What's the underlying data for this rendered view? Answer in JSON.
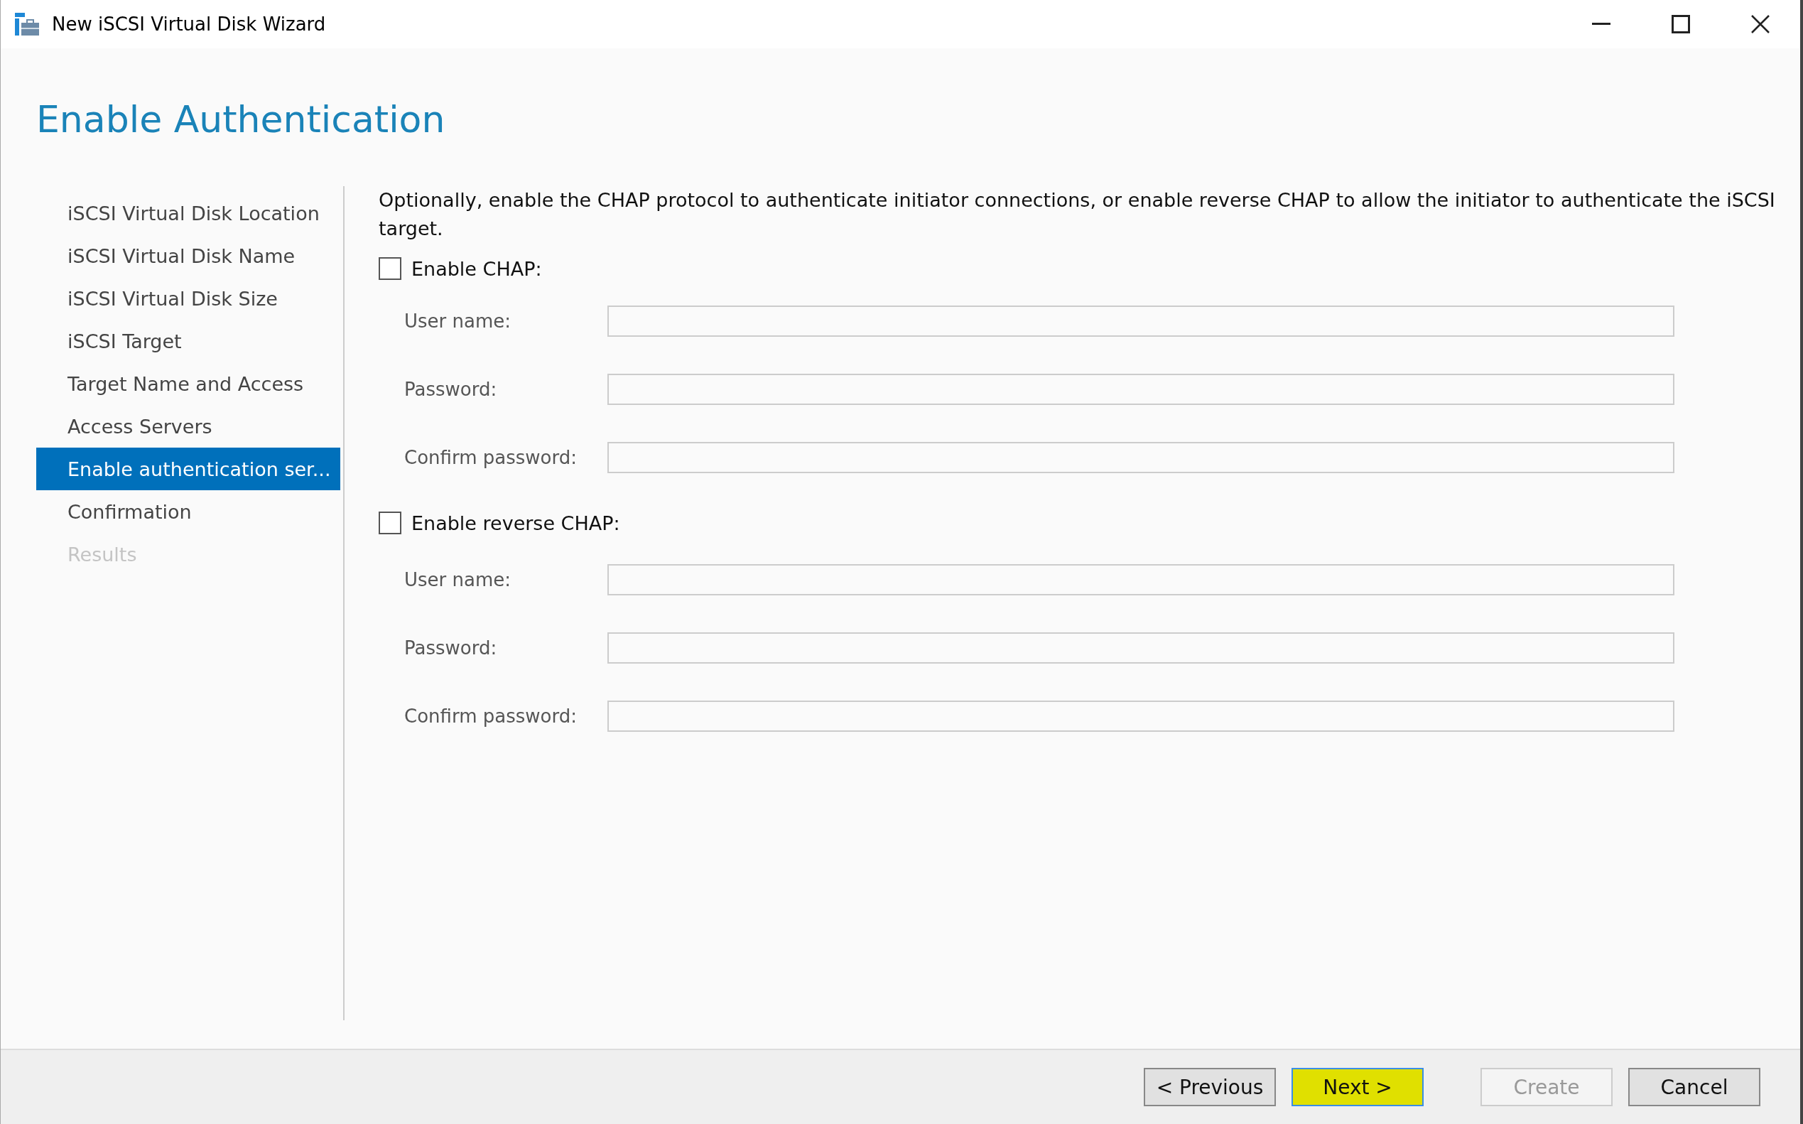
{
  "window": {
    "title": "New iSCSI Virtual Disk Wizard"
  },
  "heading": "Enable Authentication",
  "steps": [
    {
      "label": "iSCSI Virtual Disk Location",
      "selected": false,
      "disabled": false
    },
    {
      "label": "iSCSI Virtual Disk Name",
      "selected": false,
      "disabled": false
    },
    {
      "label": "iSCSI Virtual Disk Size",
      "selected": false,
      "disabled": false
    },
    {
      "label": "iSCSI Target",
      "selected": false,
      "disabled": false
    },
    {
      "label": "Target Name and Access",
      "selected": false,
      "disabled": false
    },
    {
      "label": "Access Servers",
      "selected": false,
      "disabled": false
    },
    {
      "label": "Enable authentication ser...",
      "selected": true,
      "disabled": false
    },
    {
      "label": "Confirmation",
      "selected": false,
      "disabled": false
    },
    {
      "label": "Results",
      "selected": false,
      "disabled": true
    }
  ],
  "description": "Optionally, enable the CHAP protocol to authenticate initiator connections, or enable reverse CHAP to allow the initiator to authenticate the iSCSI target.",
  "sections": [
    {
      "label": "Enable CHAP:",
      "checked": false,
      "fields": [
        {
          "label": "User name:"
        },
        {
          "label": "Password:"
        },
        {
          "label": "Confirm password:"
        }
      ]
    },
    {
      "label": "Enable reverse CHAP:",
      "checked": false,
      "fields": [
        {
          "label": "User name:"
        },
        {
          "label": "Password:"
        },
        {
          "label": "Confirm password:"
        }
      ]
    }
  ],
  "buttons": [
    {
      "label": "< Previous",
      "disabled": false,
      "highlighted": false
    },
    {
      "label": "Next >",
      "disabled": false,
      "highlighted": true
    },
    {
      "label": "Create",
      "disabled": true,
      "highlighted": false
    },
    {
      "label": "Cancel",
      "disabled": false,
      "highlighted": false
    }
  ]
}
